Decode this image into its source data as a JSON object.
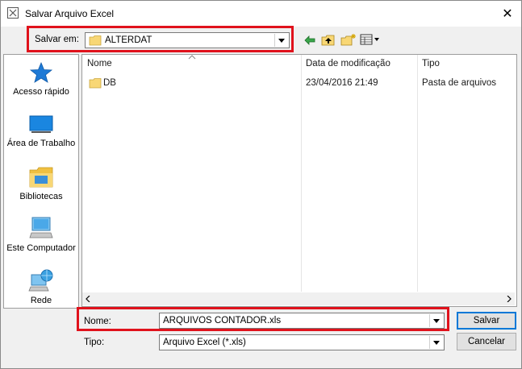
{
  "window": {
    "title": "Salvar Arquivo Excel",
    "close_glyph": "✕"
  },
  "lookin": {
    "label": "Salvar em:",
    "value": "ALTERDAT"
  },
  "toolbar": {
    "icons": [
      "back-icon",
      "up-folder-icon",
      "new-folder-icon",
      "view-menu-icon"
    ]
  },
  "places": [
    {
      "label": "Acesso rápido",
      "icon": "star-icon"
    },
    {
      "label": "Área de Trabalho",
      "icon": "desktop-icon"
    },
    {
      "label": "Bibliotecas",
      "icon": "libraries-icon"
    },
    {
      "label": "Este Computador",
      "icon": "computer-icon"
    },
    {
      "label": "Rede",
      "icon": "network-icon"
    }
  ],
  "filelist": {
    "columns": [
      "Nome",
      "Data de modificação",
      "Tipo"
    ],
    "rows": [
      {
        "name": "DB",
        "modified": "23/04/2016 21:49",
        "type": "Pasta de arquivos"
      }
    ]
  },
  "filename": {
    "label": "Nome:",
    "value": "ARQUIVOS CONTADOR.xls"
  },
  "filetype": {
    "label": "Tipo:",
    "value": "Arquivo Excel (*.xls)"
  },
  "buttons": {
    "save": "Salvar",
    "cancel": "Cancelar"
  },
  "colors": {
    "highlight_border": "#e0121c",
    "folder_yellow": "#f8d775",
    "default_button_border": "#0078d7"
  }
}
